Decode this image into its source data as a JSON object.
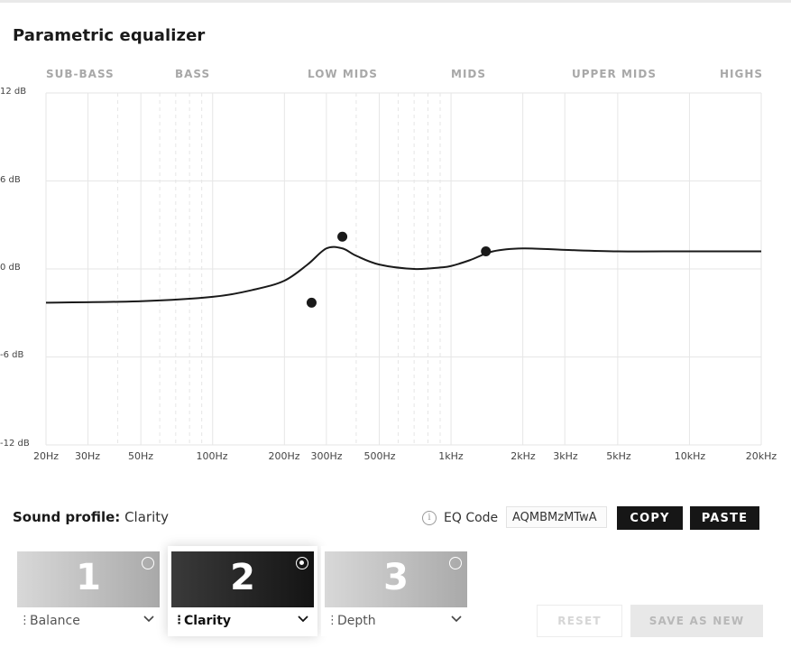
{
  "title": "Parametric equalizer",
  "bands": [
    "SUB-BASS",
    "BASS",
    "LOW MIDS",
    "MIDS",
    "UPPER MIDS",
    "HIGHS"
  ],
  "chart_data": {
    "type": "line",
    "xscale": "log",
    "x_ticks": [
      "20Hz",
      "30Hz",
      "50Hz",
      "100Hz",
      "200Hz",
      "300Hz",
      "500Hz",
      "1kHz",
      "2kHz",
      "3kHz",
      "5kHz",
      "10kHz",
      "20kHz"
    ],
    "y_ticks": [
      "12 dB",
      "6 dB",
      "0 dB",
      "-6 dB",
      "-12 dB"
    ],
    "xlim": [
      20,
      20000
    ],
    "ylim": [
      -12,
      12
    ],
    "grid": true,
    "curve": {
      "x": [
        20,
        50,
        100,
        150,
        200,
        250,
        300,
        350,
        400,
        500,
        700,
        900,
        1000,
        1200,
        1500,
        2000,
        3000,
        5000,
        10000,
        20000
      ],
      "y": [
        -2.3,
        -2.2,
        -1.9,
        -1.4,
        -0.8,
        0.3,
        1.4,
        1.4,
        0.9,
        0.3,
        0.0,
        0.1,
        0.2,
        0.6,
        1.2,
        1.4,
        1.3,
        1.2,
        1.2,
        1.2
      ]
    },
    "points": [
      {
        "x": 260,
        "y": -2.3
      },
      {
        "x": 350,
        "y": 2.2
      },
      {
        "x": 1400,
        "y": 1.2
      }
    ]
  },
  "sound_profile": {
    "label": "Sound profile:",
    "value": "Clarity"
  },
  "eq_code": {
    "info_icon": "info-icon",
    "label": "EQ Code",
    "value": "AQMBMzMTwA"
  },
  "buttons": {
    "copy": "COPY",
    "paste": "PASTE",
    "reset": "RESET",
    "save_as_new": "SAVE AS NEW"
  },
  "presets": [
    {
      "number": "1",
      "name": "Balance",
      "selected": false
    },
    {
      "number": "2",
      "name": "Clarity",
      "selected": true
    },
    {
      "number": "3",
      "name": "Depth",
      "selected": false
    }
  ],
  "colors": {
    "curve": "#1a1a1a",
    "grid": "#e6e6e6",
    "band_label": "#a8a8a8",
    "button_dark": "#161616"
  }
}
